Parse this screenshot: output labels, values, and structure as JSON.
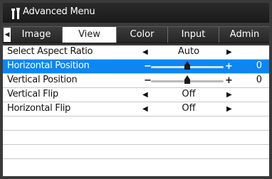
{
  "window": {
    "title": "Advanced Menu",
    "icons": [
      "wrench-icon",
      "screwdriver-icon"
    ]
  },
  "tabs": [
    {
      "label": "Image",
      "active": false
    },
    {
      "label": "View",
      "active": true
    },
    {
      "label": "Color",
      "active": false
    },
    {
      "label": "Input",
      "active": false
    },
    {
      "label": "Admin",
      "active": false
    }
  ],
  "rows": [
    {
      "label": "Select Aspect Ratio",
      "type": "select",
      "value": "Auto"
    },
    {
      "label": "Horizontal Position",
      "type": "slider",
      "value": "0",
      "level": 0.5,
      "selected": true
    },
    {
      "label": "Vertical Position",
      "type": "slider",
      "value": "0",
      "level": 0.5
    },
    {
      "label": "Vertical Flip",
      "type": "select",
      "value": "Off"
    },
    {
      "label": "Horizontal Flip",
      "type": "select",
      "value": "Off"
    }
  ],
  "colors": {
    "accent": "#0d86f0",
    "frame": "#3a3a3a"
  }
}
